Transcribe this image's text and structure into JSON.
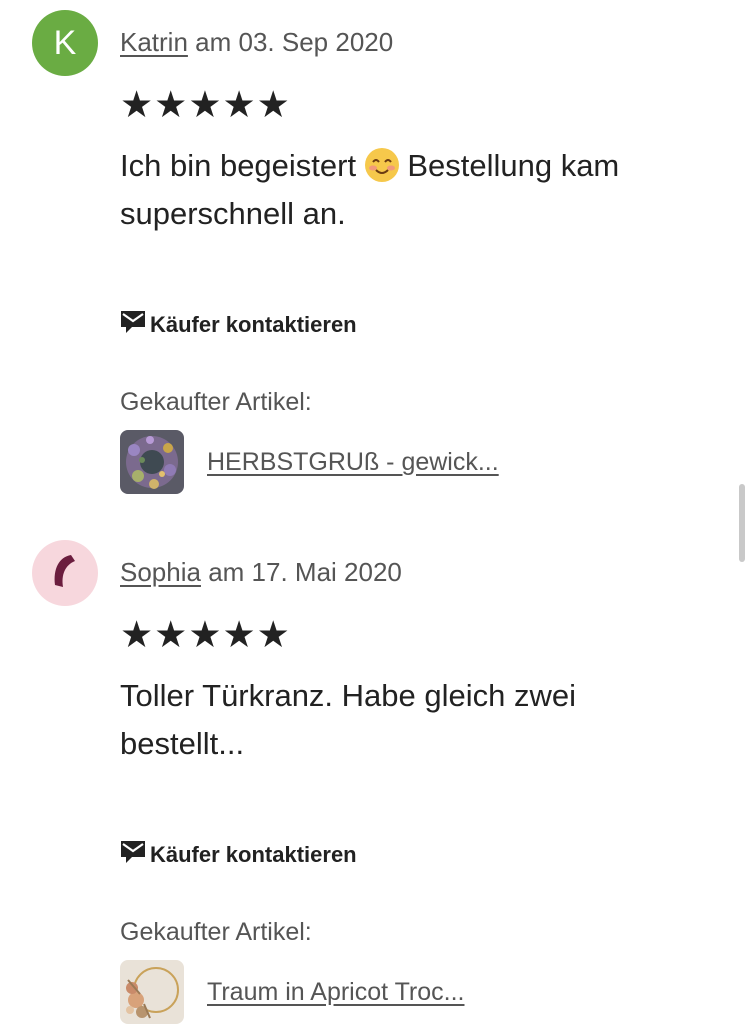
{
  "reviews": [
    {
      "avatar_letter": "K",
      "avatar_color": "#6aac43",
      "author": "Katrin",
      "date_prefix": " am ",
      "date": "03. Sep 2020",
      "stars": "★★★★★",
      "rating": 5,
      "text_before_emoji": "Ich bin begeistert ",
      "emoji_icon": "smiling-face-emoji",
      "text_after_emoji": " Bestellung kam superschnell an.",
      "contact_label": "Käufer kontaktieren",
      "purchased_label": "Gekaufter Artikel:",
      "item_title": "HERBSTGRUß - gewick..."
    },
    {
      "avatar_icon": "crescent-logo",
      "avatar_color": "#f7d7dd",
      "avatar_icon_color": "#6b1d3e",
      "author": "Sophia",
      "date_prefix": " am ",
      "date": "17. Mai 2020",
      "stars": "★★★★★",
      "rating": 5,
      "text": "Toller Türkranz. Habe gleich zwei bestellt...",
      "contact_label": "Käufer kontaktieren",
      "purchased_label": "Gekaufter Artikel:",
      "item_title": "Traum in Apricot Troc..."
    }
  ],
  "colors": {
    "text": "#222222",
    "muted": "#555555",
    "emoji": "#f6c84b"
  }
}
